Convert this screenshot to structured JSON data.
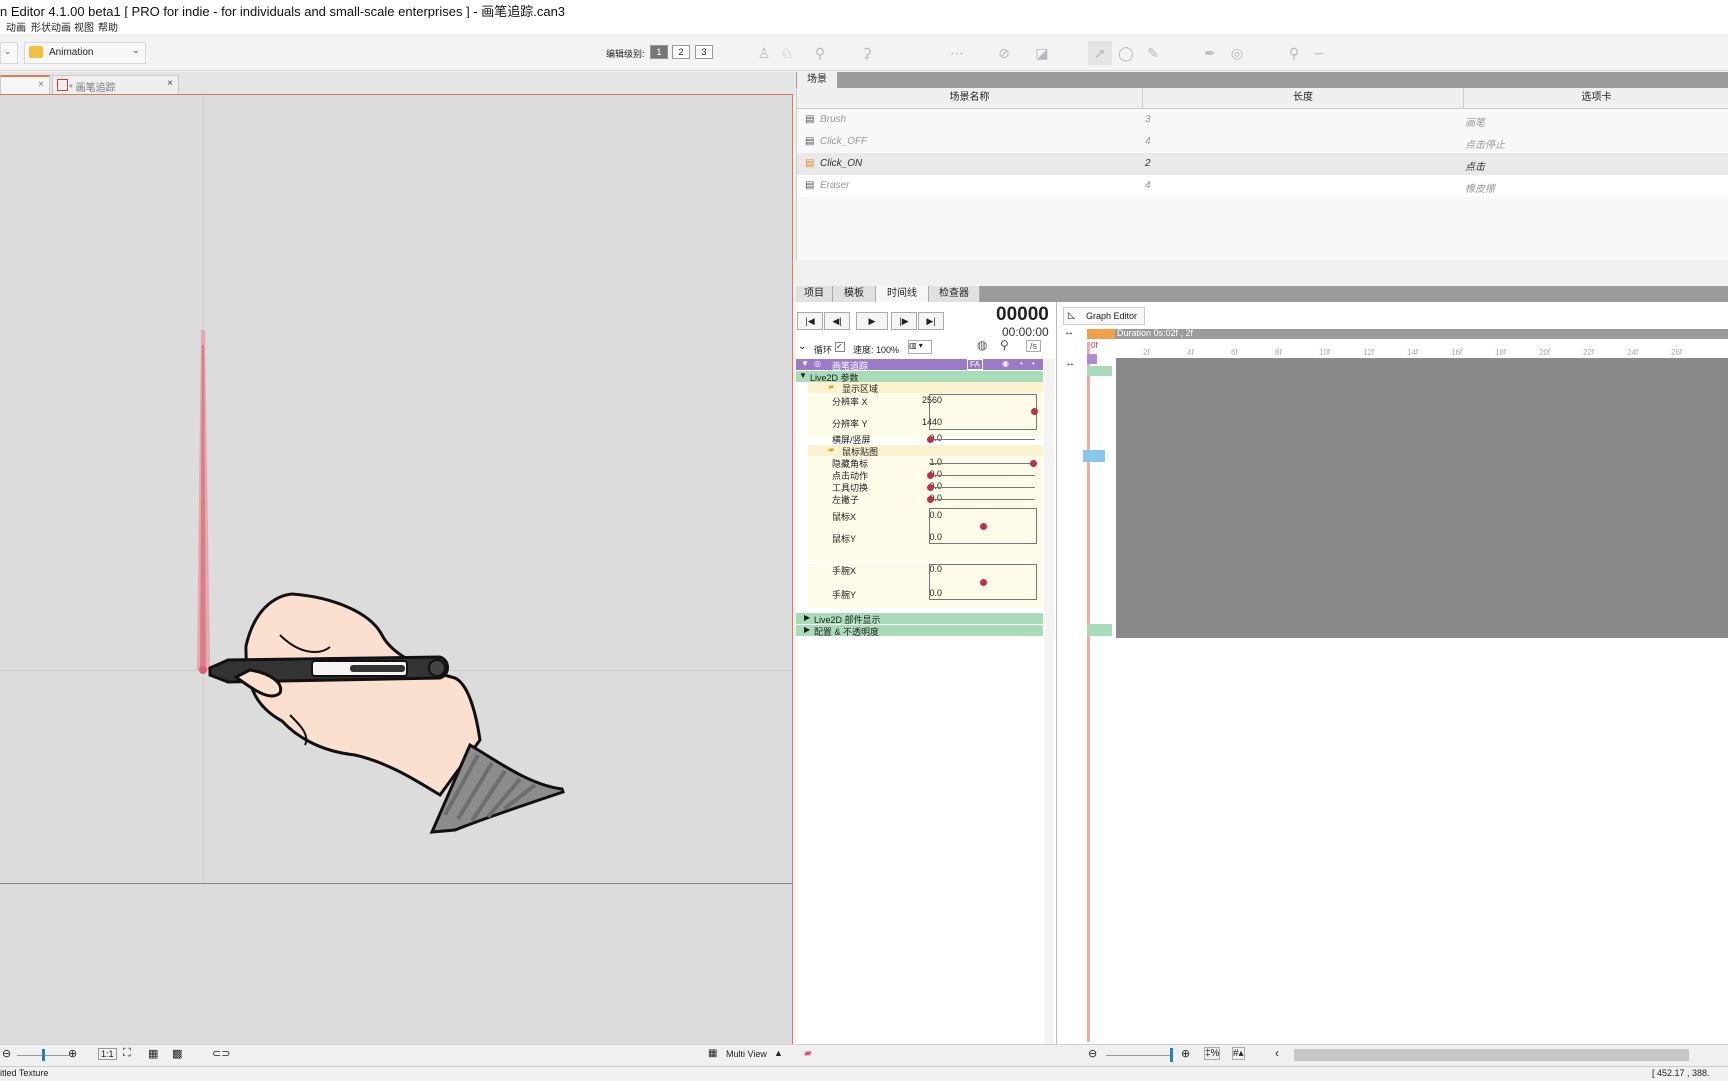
{
  "window": {
    "title": "n Editor 4.1.00 beta1    [ PRO for indie - for individuals and small-scale enterprises ]  - 画笔追踪.can3"
  },
  "menu": [
    "动画",
    "形状动画",
    "视图",
    "帮助"
  ],
  "toolbar": {
    "workspace": "Animation",
    "edit_level_label": "编辑级别:",
    "levels": [
      "1",
      "2",
      "3"
    ]
  },
  "doc_tabs": {
    "tab2": "* 画笔追踪"
  },
  "canvas_bottom": {
    "ratio": "1:1",
    "multiview": "Multi View"
  },
  "status": {
    "left": "itled Texture",
    "coords": "[    452.17 ,   388."
  },
  "scene": {
    "tab": "场景",
    "headers": [
      "场景名称",
      "长度",
      "选项卡"
    ],
    "rows": [
      {
        "name": "Brush",
        "length": "3",
        "tab": "画笔"
      },
      {
        "name": "Click_OFF",
        "length": "4",
        "tab": "点击停止"
      },
      {
        "name": "Click_ON",
        "length": "2",
        "tab": "点击"
      },
      {
        "name": "Eraser",
        "length": "4",
        "tab": "橡皮擦"
      }
    ]
  },
  "timeline": {
    "tabs": [
      "项目",
      "模板",
      "时间线",
      "检查器"
    ],
    "frame": "00000",
    "time": "00:00:00",
    "loop_label": "循环",
    "speed": "速度: 100%",
    "graph_editor": "Graph Editor",
    "duration": "Duration 0s:02f , 2f",
    "zero": "0f",
    "track": "画笔追踪",
    "ruler": [
      "2f",
      "4f",
      "6f",
      "8f",
      "10f",
      "12f",
      "14f",
      "16f",
      "18f",
      "20f",
      "22f",
      "24f",
      "26f"
    ],
    "params_group": "Live2D 参数",
    "folder1": "显示区域",
    "folder2": "鼠标贴图",
    "params": [
      {
        "label": "分辨率 X",
        "value": "2560"
      },
      {
        "label": "分辨率 Y",
        "value": "1440"
      },
      {
        "label": "横屏/竖屏",
        "value": "0.0"
      },
      {
        "label": "隐藏角标",
        "value": "1.0"
      },
      {
        "label": "点击动作",
        "value": "0.0"
      },
      {
        "label": "工具切换",
        "value": "0.0"
      },
      {
        "label": "左撇子",
        "value": "0.0"
      },
      {
        "label": "鼠标X",
        "value": "0.0"
      },
      {
        "label": "鼠标Y",
        "value": "0.0"
      },
      {
        "label": "手腕X",
        "value": "0.0"
      },
      {
        "label": "手腕Y",
        "value": "0.0"
      }
    ],
    "group2": "Live2D 部件显示",
    "group3": "配置 & 不透明度"
  }
}
